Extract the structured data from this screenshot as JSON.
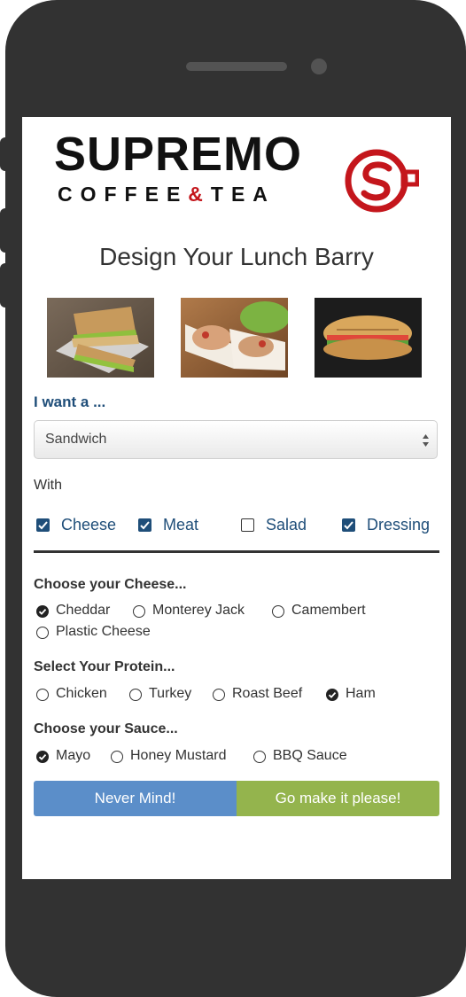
{
  "brand": {
    "name_line1": "SUPREMO",
    "name_line2_a": "COFFEE",
    "name_line2_amp": "&",
    "name_line2_b": "TEA",
    "accent_color": "#c4161c"
  },
  "page": {
    "title": "Design Your Lunch Barry"
  },
  "photos": [
    "sandwich-photo",
    "wrap-photo",
    "panini-photo"
  ],
  "meal_type": {
    "label": "I want a ...",
    "selected": "Sandwich"
  },
  "extras": {
    "label": "With",
    "items": [
      {
        "label": "Cheese",
        "checked": true
      },
      {
        "label": "Meat",
        "checked": true
      },
      {
        "label": "Salad",
        "checked": false
      },
      {
        "label": "Dressing",
        "checked": true
      }
    ]
  },
  "cheese": {
    "title": "Choose your Cheese...",
    "options": [
      "Cheddar",
      "Monterey Jack",
      "Camembert",
      "Plastic Cheese"
    ],
    "selected": "Cheddar"
  },
  "protein": {
    "title": "Select Your Protein...",
    "options": [
      "Chicken",
      "Turkey",
      "Roast Beef",
      "Ham"
    ],
    "selected": "Ham"
  },
  "sauce": {
    "title": "Choose your Sauce...",
    "options": [
      "Mayo",
      "Honey Mustard",
      "BBQ Sauce"
    ],
    "selected": "Mayo"
  },
  "actions": {
    "cancel_label": "Never Mind!",
    "submit_label": "Go make it please!",
    "cancel_color": "#5b8ec9",
    "submit_color": "#94b44d"
  }
}
